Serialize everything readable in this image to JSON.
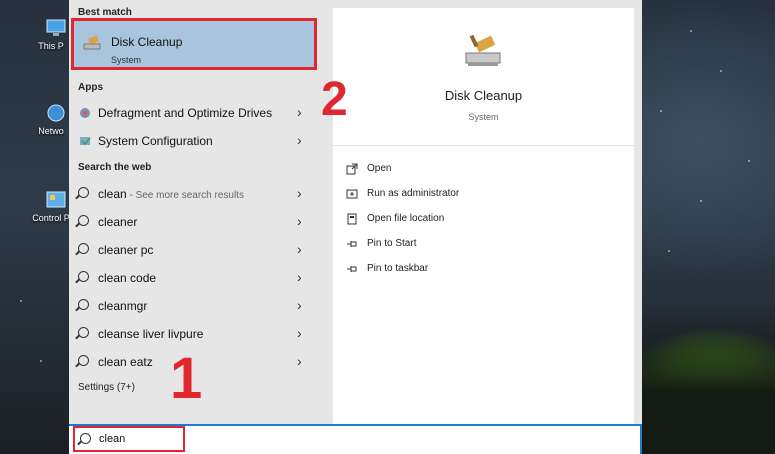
{
  "desktop": {
    "icons": [
      {
        "label": "This P"
      },
      {
        "label": "Netwo"
      },
      {
        "label": "Control P"
      }
    ]
  },
  "left": {
    "best_match_label": "Best match",
    "best_match": {
      "title": "Disk Cleanup",
      "subtitle": "System",
      "icon": "disk-cleanup-icon"
    },
    "apps_label": "Apps",
    "apps": [
      {
        "label": "Defragment and Optimize Drives",
        "icon": "defrag-icon"
      },
      {
        "label": "System Configuration",
        "icon": "system-config-icon"
      }
    ],
    "web_label": "Search the web",
    "web_results": [
      {
        "term": "clean",
        "hint": " - See more search results"
      },
      {
        "term": "cleaner",
        "hint": ""
      },
      {
        "term": "cleaner pc",
        "hint": ""
      },
      {
        "term": "clean code",
        "hint": ""
      },
      {
        "term": "cleanmgr",
        "hint": ""
      },
      {
        "term": "cleanse liver livpure",
        "hint": ""
      },
      {
        "term": "clean eatz",
        "hint": ""
      }
    ],
    "settings_label": "Settings (7+)",
    "chevron": "›"
  },
  "right": {
    "title": "Disk Cleanup",
    "subtitle": "System",
    "actions": [
      {
        "label": "Open",
        "icon": "open-icon"
      },
      {
        "label": "Run as administrator",
        "icon": "run-admin-icon"
      },
      {
        "label": "Open file location",
        "icon": "file-location-icon"
      },
      {
        "label": "Pin to Start",
        "icon": "pin-icon"
      },
      {
        "label": "Pin to taskbar",
        "icon": "pin-icon"
      }
    ]
  },
  "search": {
    "value": "clean"
  },
  "annotations": {
    "step1": "1",
    "step2": "2"
  },
  "colors": {
    "highlight": "#a8c5dd",
    "annotation": "#e0262e",
    "accent": "#1e7bd3"
  }
}
